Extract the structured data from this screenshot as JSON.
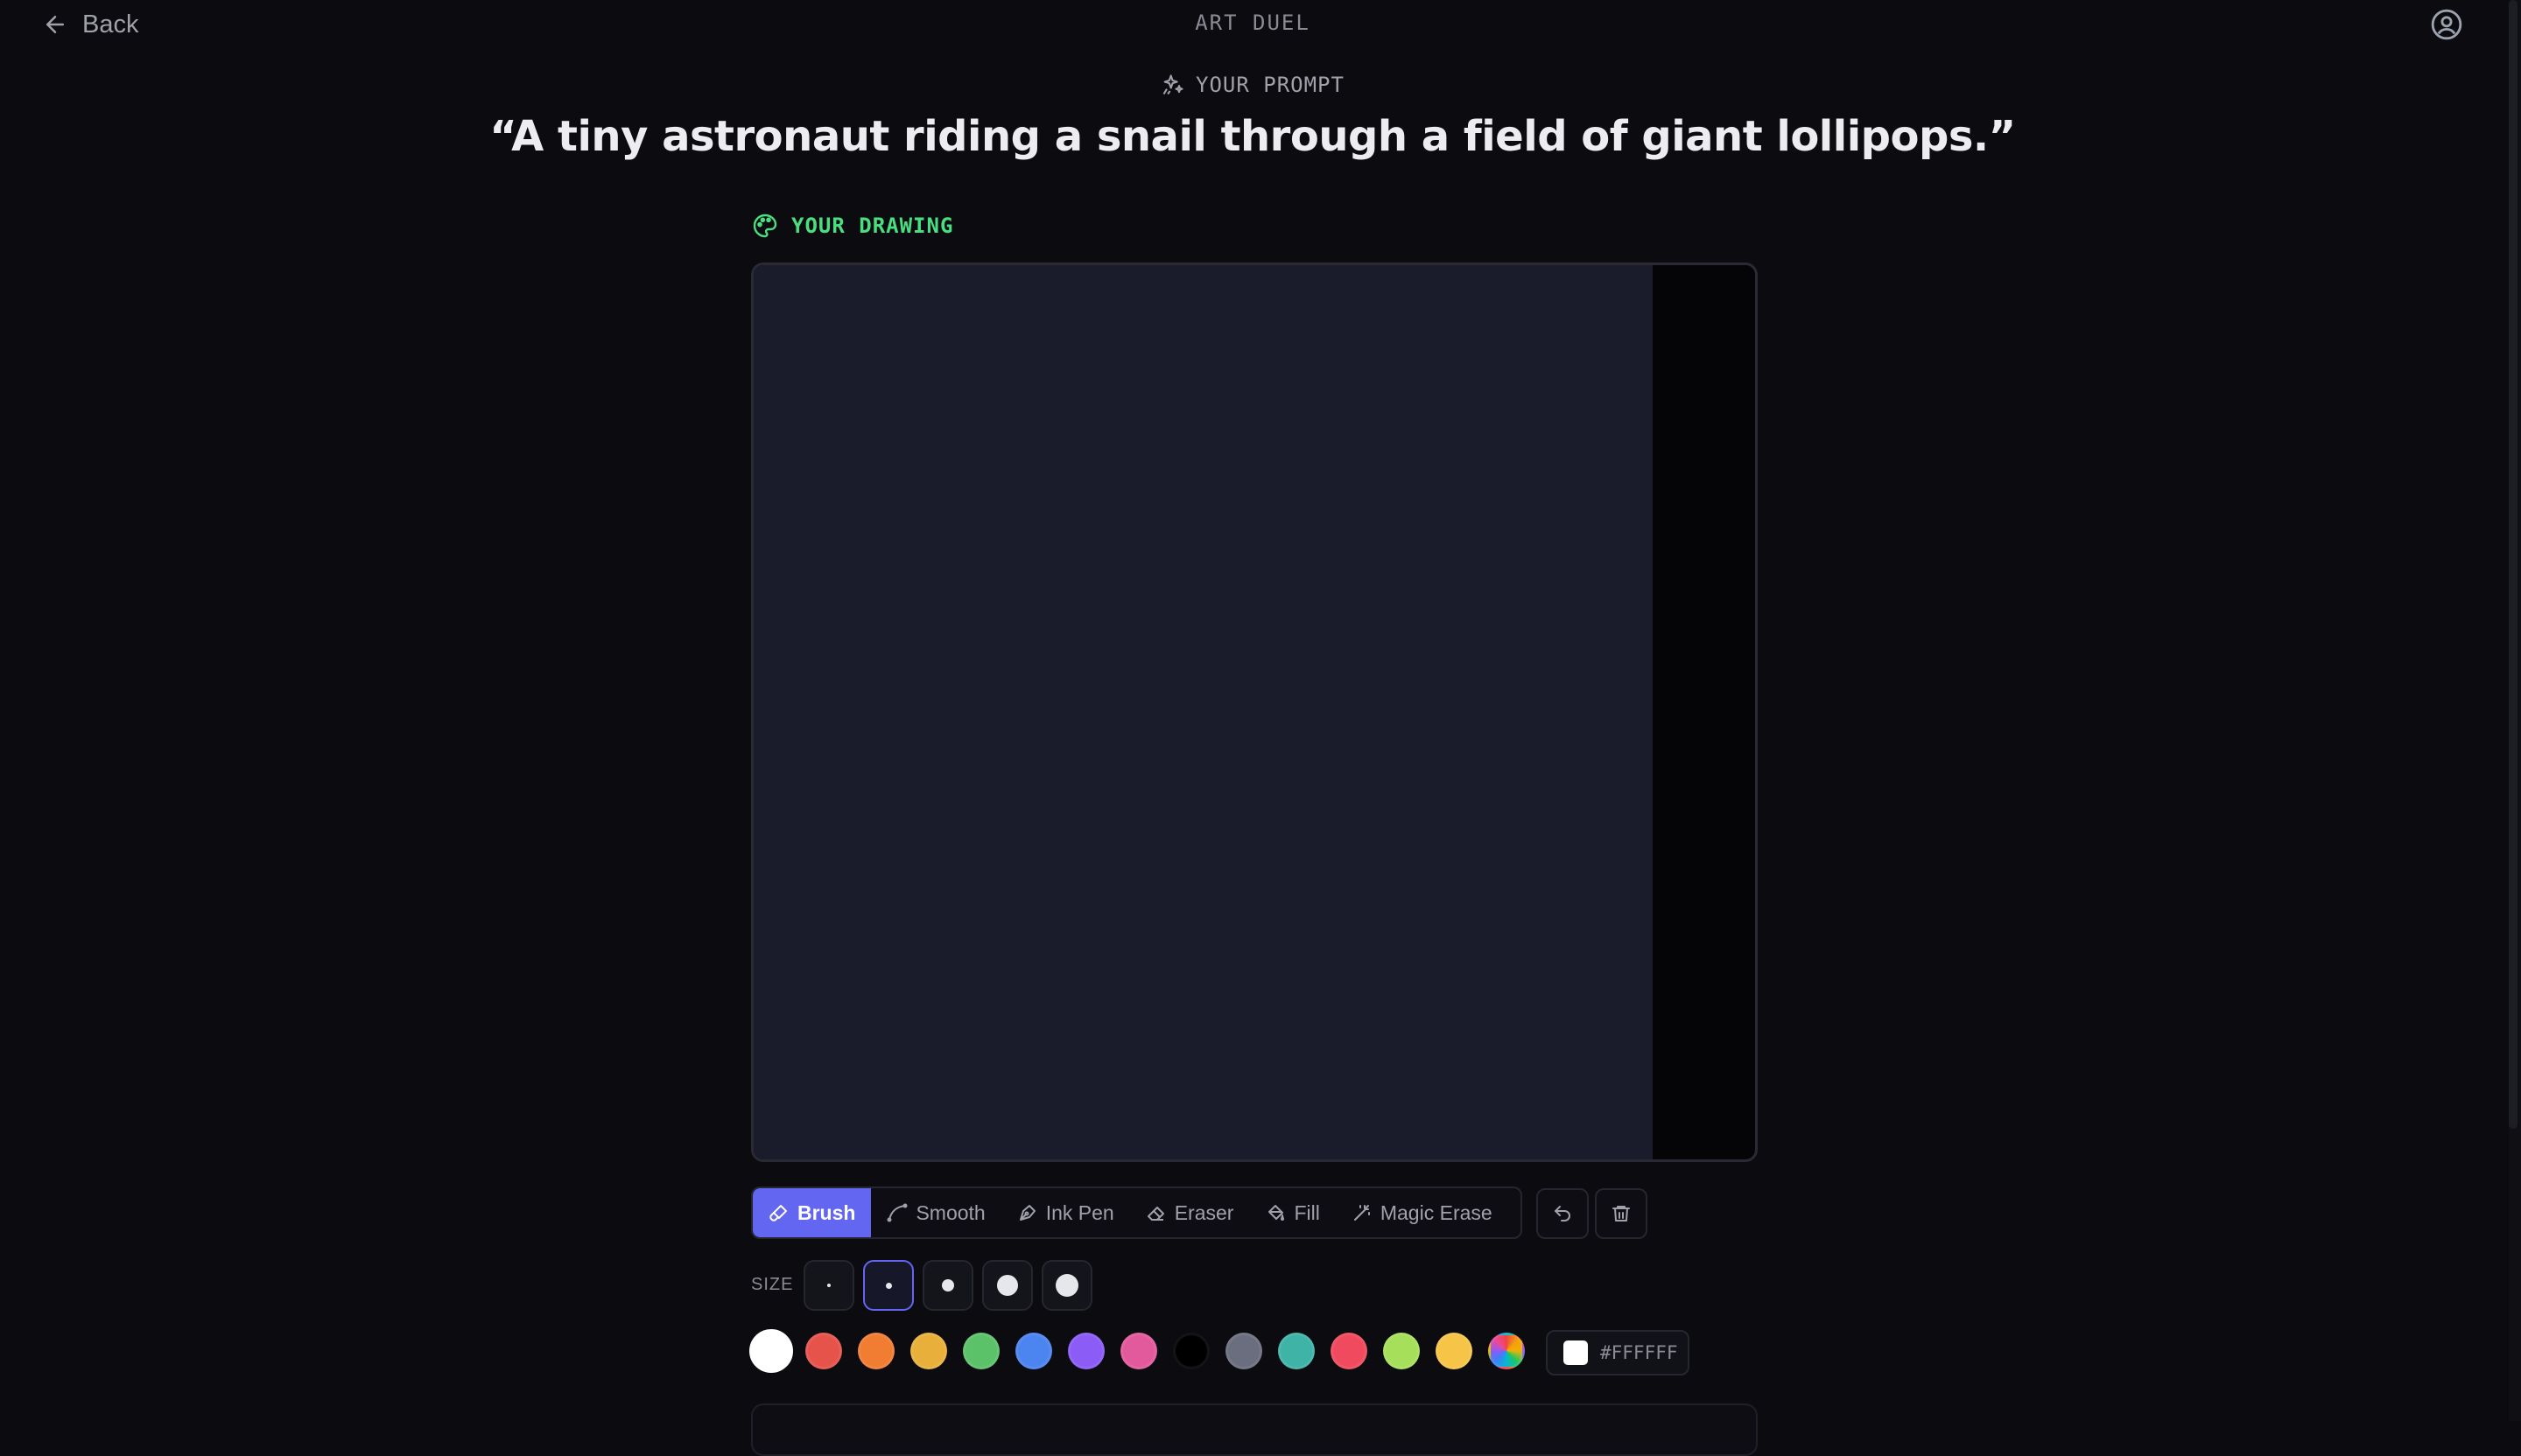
{
  "header": {
    "back_label": "Back",
    "app_title": "ART DUEL"
  },
  "prompt": {
    "label": "YOUR PROMPT",
    "text": "“A tiny astronaut riding a snail through a field of giant lollipops.”"
  },
  "drawing": {
    "label": "YOUR DRAWING"
  },
  "toolbar": {
    "tools": [
      {
        "label": "Brush",
        "icon": "brush-icon",
        "active": true
      },
      {
        "label": "Smooth",
        "icon": "curve-icon",
        "active": false
      },
      {
        "label": "Ink Pen",
        "icon": "pen-icon",
        "active": false
      },
      {
        "label": "Eraser",
        "icon": "eraser-icon",
        "active": false
      },
      {
        "label": "Fill",
        "icon": "paint-bucket-icon",
        "active": false
      },
      {
        "label": "Magic Erase",
        "icon": "magic-wand-icon",
        "active": false
      }
    ],
    "undo_icon": "undo-icon",
    "clear_icon": "trash-icon"
  },
  "size": {
    "label": "SIZE",
    "options": [
      "xs",
      "s",
      "m",
      "l",
      "xl"
    ],
    "selected_index": 1
  },
  "palette": {
    "colors": [
      "#FFFFFF",
      "#E5534B",
      "#F07D32",
      "#E8B03A",
      "#5CC26A",
      "#4C84F0",
      "#8B5CF6",
      "#E25A9C",
      "#000000",
      "#6B6E7E",
      "#3FB3A6",
      "#EF4A5E",
      "#A6E05A",
      "#F6C548"
    ],
    "selected_color": "#FFFFFF",
    "custom_icon": "color-wheel-icon",
    "hex_value": "#FFFFFF"
  },
  "colors": {
    "accent": "#6366F1",
    "drawing_label": "#4ADE80",
    "canvas_background": "#1B1C2B"
  }
}
